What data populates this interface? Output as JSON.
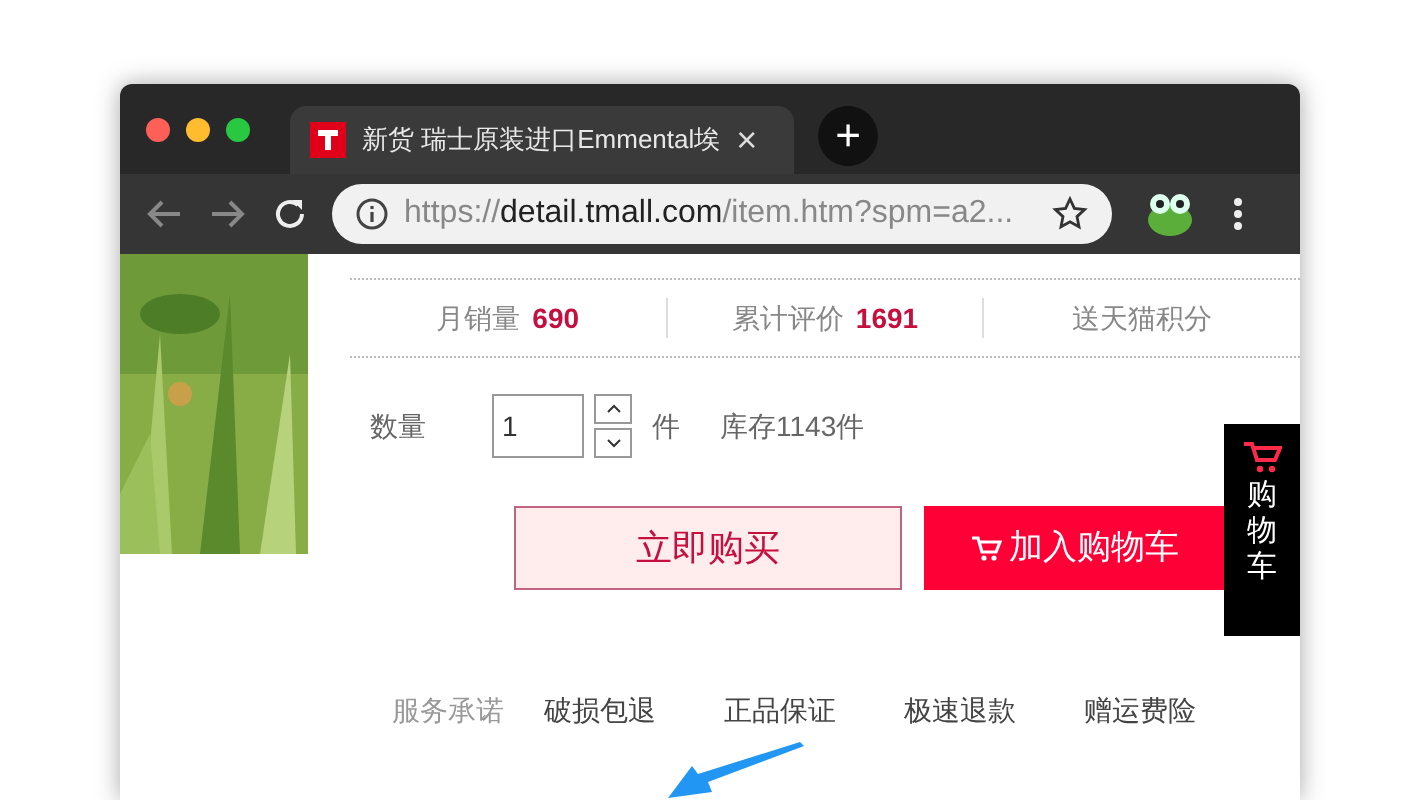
{
  "window": {
    "tab": {
      "title": "新货 瑞士原装进口Emmental埃",
      "selected": true,
      "close": "×"
    },
    "new_tab": "+"
  },
  "address_bar": {
    "scheme": "https://",
    "host": "detail.tmall.com",
    "path": "/item.htm?spm=a2..."
  },
  "stats": [
    {
      "label": "月销量",
      "value": "690"
    },
    {
      "label": "累计评价",
      "value": "1691"
    },
    {
      "label": "送天猫积分"
    }
  ],
  "quantity": {
    "label": "数量",
    "value": "1",
    "unit": "件",
    "stock": "库存1143件"
  },
  "buttons": {
    "buy_now": "立即购买",
    "add_to_cart": "加入购物车"
  },
  "side_cart": {
    "label": "购物车"
  },
  "services": {
    "label": "服务承诺",
    "items": [
      "破损包退",
      "正品保证",
      "极速退款",
      "赠运费险"
    ]
  }
}
